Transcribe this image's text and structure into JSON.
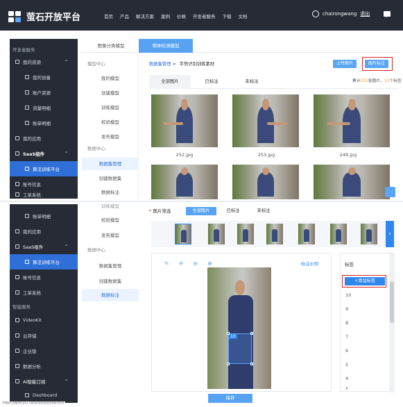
{
  "header": {
    "brand": "萤石开放平台",
    "nav": [
      "首页",
      "产品",
      "解决方案",
      "案例",
      "价格",
      "开发者服务",
      "下载",
      "文档"
    ],
    "username": "chairongwang",
    "logout": "退出"
  },
  "sidebar_top": {
    "section": "开发者服务",
    "items": [
      {
        "label": "我的资源",
        "icon": "user-icon"
      },
      {
        "label": "我的设备",
        "icon": "device-icon"
      },
      {
        "label": "账户资源",
        "icon": "bar-chart-icon"
      },
      {
        "label": "流量明细",
        "icon": "flow-icon"
      },
      {
        "label": "账单明细",
        "icon": "bill-icon"
      },
      {
        "label": "我的应用",
        "icon": "grid-icon"
      },
      {
        "label": "SaaS组件",
        "icon": "saas-icon"
      },
      {
        "label": "算法训练平台",
        "icon": "algorithm-icon"
      },
      {
        "label": "账号信息",
        "icon": "account-icon"
      },
      {
        "label": "工单系统",
        "icon": "ticket-icon"
      }
    ]
  },
  "top_tabs": [
    "图像分类模型",
    "物体检测模型"
  ],
  "model_menu": {
    "head1": "模型中心",
    "models": [
      "我的模型",
      "创建模型",
      "训练模型",
      "校验模型",
      "发布模型"
    ],
    "head2": "数据中心",
    "data": [
      "数据集管理",
      "创建数据集",
      "数据标注"
    ]
  },
  "breadcrumb": {
    "link": "数据集管理",
    "sep": ">",
    "current": "手势识别训练素材"
  },
  "buttons": {
    "upload": "上传图片",
    "annotate": "图片标注",
    "save": "保存"
  },
  "subtabs": [
    "全部图片",
    "已标注",
    "未标注"
  ],
  "stats": {
    "prefix": "累计",
    "total": "255",
    "mid": "张图片，",
    "count": "10",
    "suffix": "个标签"
  },
  "images": [
    "252.jpg",
    "253.jpg",
    "248.jpg"
  ],
  "sidebar_bottom": {
    "items": [
      {
        "label": "账单明细",
        "icon": "bill-icon"
      },
      {
        "label": "我的应用",
        "icon": "grid-icon"
      },
      {
        "label": "SaaS组件",
        "icon": "saas-icon"
      },
      {
        "label": "算法训练平台",
        "icon": "algorithm-icon"
      },
      {
        "label": "账号信息",
        "icon": "account-icon"
      },
      {
        "label": "工单系统",
        "icon": "ticket-icon"
      }
    ],
    "section": "智能服务",
    "items2": [
      {
        "label": "VideoKit",
        "icon": "video-icon"
      },
      {
        "label": "云存储",
        "icon": "cloud-icon"
      },
      {
        "label": "企业版",
        "icon": "enterprise-icon"
      },
      {
        "label": "数据分析",
        "icon": "analytics-icon"
      },
      {
        "label": "AI智能订阅",
        "icon": "ai-icon"
      },
      {
        "label": "Dashboard",
        "icon": "dashboard-icon"
      }
    ]
  },
  "model_menu2": {
    "models": [
      "训练模型",
      "校验模型",
      "发布模型"
    ],
    "head": "数据中心",
    "data": [
      "数据集管理",
      "创建数据集",
      "数据标注"
    ]
  },
  "filter": {
    "label": "图片筛选",
    "tabs": [
      "全部图片",
      "已标注",
      "未标注"
    ]
  },
  "editor": {
    "example": "标注示例",
    "box_label": "10"
  },
  "labels": {
    "title": "标签",
    "add": "+添加标签",
    "items": [
      "10",
      "9",
      "8",
      "7",
      "6",
      "5",
      "4",
      "3"
    ]
  },
  "status_url": "https://open.ys7.com/console/flow.html"
}
